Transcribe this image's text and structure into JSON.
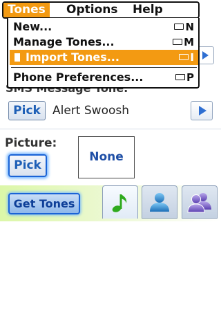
{
  "menubar": {
    "titles": [
      "Tones",
      "Options",
      "Help"
    ],
    "active": "Tones"
  },
  "dropdown": {
    "items": [
      {
        "label": "New...",
        "shortcut": "N"
      },
      {
        "label": "Manage Tones...",
        "shortcut": "M"
      },
      {
        "label": "Import Tones...",
        "shortcut": "I"
      },
      {
        "label": "Phone Preferences...",
        "shortcut": "P"
      }
    ],
    "highlighted_index": 2
  },
  "screen": {
    "sms_label": "SMS Message Tone:",
    "sms_pick": "Pick",
    "sms_tone": "Alert Swoosh",
    "picture_label": "Picture:",
    "picture_pick": "Pick",
    "picture_value": "None",
    "get_tones": "Get Tones"
  },
  "tabs": [
    {
      "name": "tones",
      "icon": "music-note-icon"
    },
    {
      "name": "contact",
      "icon": "person-icon"
    },
    {
      "name": "group",
      "icon": "people-icon"
    }
  ],
  "colors": {
    "highlight": "#f39a12",
    "accent": "#1a63d6",
    "bar_green": "#dcf7a8"
  }
}
